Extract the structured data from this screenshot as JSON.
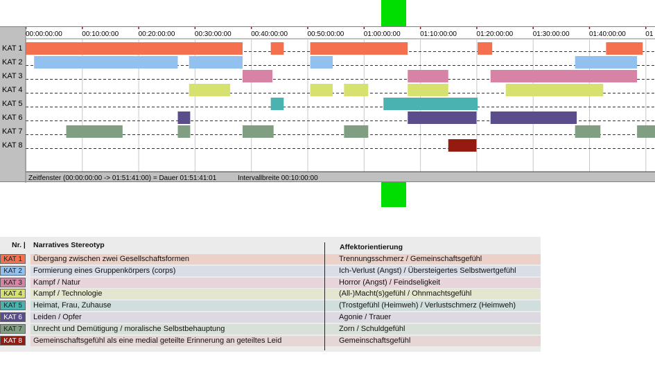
{
  "colors": {
    "KAT 1": "#f4704f",
    "KAT 2": "#92c1ef",
    "KAT 3": "#d783a5",
    "KAT 4": "#d6e16f",
    "KAT 5": "#4ab2b0",
    "KAT 6": "#5b4d8c",
    "KAT 7": "#7f9e82",
    "KAT 8": "#951b11"
  },
  "chart_data": {
    "type": "timeline",
    "x_unit": "minutes",
    "x_range": [
      0,
      111.7
    ],
    "tick_labels": [
      "00:00:00:00",
      "00:10:00:00",
      "00:20:00:00",
      "00:30:00:00",
      "00:40:00:00",
      "00:50:00:00",
      "01:00:00:00",
      "01:10:00:00",
      "01:20:00:00",
      "01:30:00:00",
      "01:40:00:00",
      "01"
    ],
    "tick_values": [
      0,
      10,
      20,
      30,
      40,
      50,
      60,
      70,
      80,
      90,
      100,
      110
    ],
    "rows": [
      {
        "label": "KAT 1",
        "segments": [
          [
            0,
            38.5
          ],
          [
            43.5,
            45.8
          ],
          [
            50.5,
            67.8
          ],
          [
            80.2,
            82.8
          ],
          [
            103,
            109.5
          ]
        ]
      },
      {
        "label": "KAT 2",
        "segments": [
          [
            1.5,
            27
          ],
          [
            29,
            38.5
          ],
          [
            50.5,
            54.5
          ],
          [
            97.5,
            108.5
          ]
        ]
      },
      {
        "label": "KAT 3",
        "segments": [
          [
            38.5,
            43.8
          ],
          [
            67.8,
            75
          ],
          [
            82.5,
            108.5
          ]
        ]
      },
      {
        "label": "KAT 4",
        "segments": [
          [
            29,
            36.3
          ],
          [
            50.5,
            54.5
          ],
          [
            56.5,
            60.8
          ],
          [
            67.8,
            75
          ],
          [
            85.2,
            102.5
          ]
        ]
      },
      {
        "label": "KAT 5",
        "segments": [
          [
            43.5,
            45.8
          ],
          [
            63.5,
            80.2
          ]
        ]
      },
      {
        "label": "KAT 6",
        "segments": [
          [
            27,
            29.2
          ],
          [
            67.8,
            80
          ],
          [
            82.5,
            97.8
          ]
        ]
      },
      {
        "label": "KAT 7",
        "segments": [
          [
            7.2,
            17.2
          ],
          [
            27,
            29.2
          ],
          [
            38.5,
            44
          ],
          [
            56.5,
            60.8
          ],
          [
            97.5,
            102
          ],
          [
            108.5,
            112
          ]
        ]
      },
      {
        "label": "KAT 8",
        "segments": [
          [
            75,
            80
          ]
        ]
      }
    ]
  },
  "status_bar": {
    "zeitfenster": "Zeitfenster (00:00:00:00 -> 01:51:41:00) = Dauer 01:51:41:01",
    "intervall": "Intervallbreite 00:10:00:00"
  },
  "legend": {
    "headers": {
      "nr": "Nr. |",
      "stereotyp": "Narratives Stereotyp",
      "affekt": "Affektorientierung"
    },
    "rows": [
      {
        "tag": "KAT 1",
        "name": "Übergang zwischen zwei Gesellschaftsformen",
        "affekt": "Trennungsschmerz / Gemeinschaftsgefühl",
        "bar": "#ebd1c8"
      },
      {
        "tag": "KAT 2",
        "name": "Formierung eines Gruppenkörpers (corps)",
        "affekt": "Ich-Verlust (Angst) / Übersteigertes Selbstwertgefühl",
        "bar": "#d8dde6"
      },
      {
        "tag": "KAT 3",
        "name": "Kampf / Natur",
        "affekt": "Horror (Angst) / Feindseligkeit",
        "bar": "#e7d5db"
      },
      {
        "tag": "KAT 4",
        "name": "Kampf / Technologie",
        "affekt": "(All-)Macht(s)gefühl / Ohnmachtsgefühl",
        "bar": "#e5e6d0"
      },
      {
        "tag": "KAT 5",
        "name": "Heimat, Frau, Zuhause",
        "affekt": "(Trostgefühl (Heimweh) / Verlustschmerz (Heimweh)",
        "bar": "#d0dfdd"
      },
      {
        "tag": "KAT 6",
        "name": "Leiden / Opfer",
        "affekt": "Agonie / Trauer",
        "bar": "#dcd9e2"
      },
      {
        "tag": "KAT 7",
        "name": "Unrecht und Demütigung / moralische Selbstbehauptung",
        "affekt": "Zorn / Schuldgefühl",
        "bar": "#d9dfd9"
      },
      {
        "tag": "KAT 8",
        "name": "Gemeinschaftsgefühl als eine medial geteilte Erinnerung an geteiltes Leid",
        "affekt": "Gemeinschaftsgefühl",
        "bar": "#e7d6d6"
      }
    ]
  }
}
